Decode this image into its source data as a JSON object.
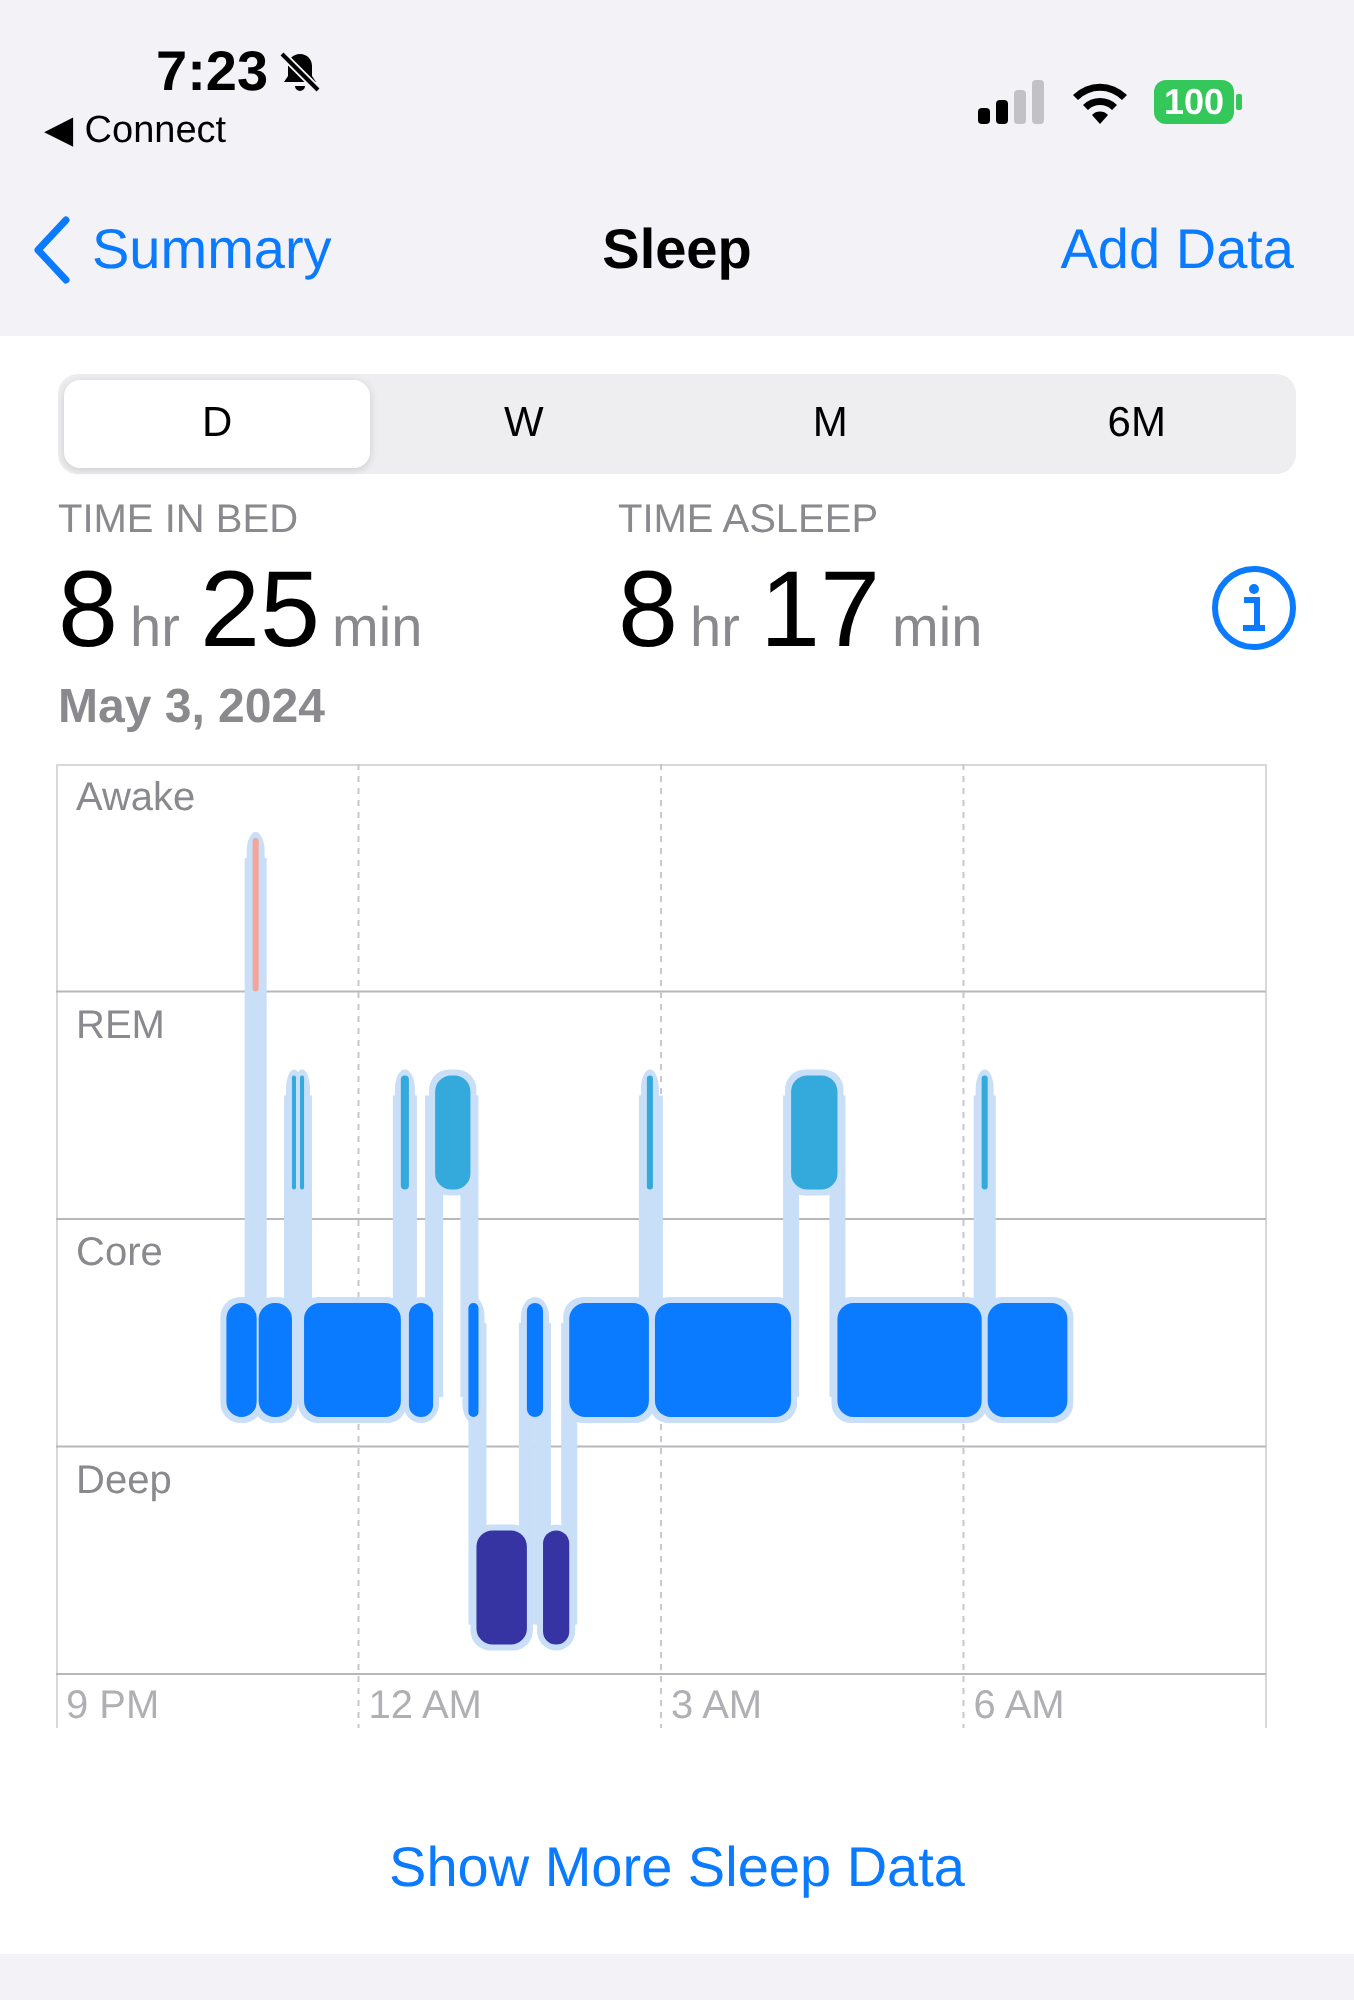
{
  "status_bar": {
    "time": "7:23",
    "back_app": "◀ Connect",
    "battery": "100"
  },
  "nav": {
    "back": "Summary",
    "title": "Sleep",
    "action": "Add Data"
  },
  "segments": [
    {
      "label": "D",
      "selected": true
    },
    {
      "label": "W",
      "selected": false
    },
    {
      "label": "M",
      "selected": false
    },
    {
      "label": "6M",
      "selected": false
    }
  ],
  "stats": [
    {
      "label": "TIME IN BED",
      "parts": [
        {
          "value": "8",
          "unit": "hr"
        },
        {
          "value": "25",
          "unit": "min"
        }
      ]
    },
    {
      "label": "TIME ASLEEP",
      "parts": [
        {
          "value": "8",
          "unit": "hr"
        },
        {
          "value": "17",
          "unit": "min"
        }
      ]
    }
  ],
  "date": "May 3, 2024",
  "sleep_chart": {
    "stages": [
      "Awake",
      "REM",
      "Core",
      "Deep"
    ],
    "time_labels": [
      "9 PM",
      "12 AM",
      "3 AM",
      "6 AM"
    ]
  },
  "more_link": "Show More Sleep Data"
}
